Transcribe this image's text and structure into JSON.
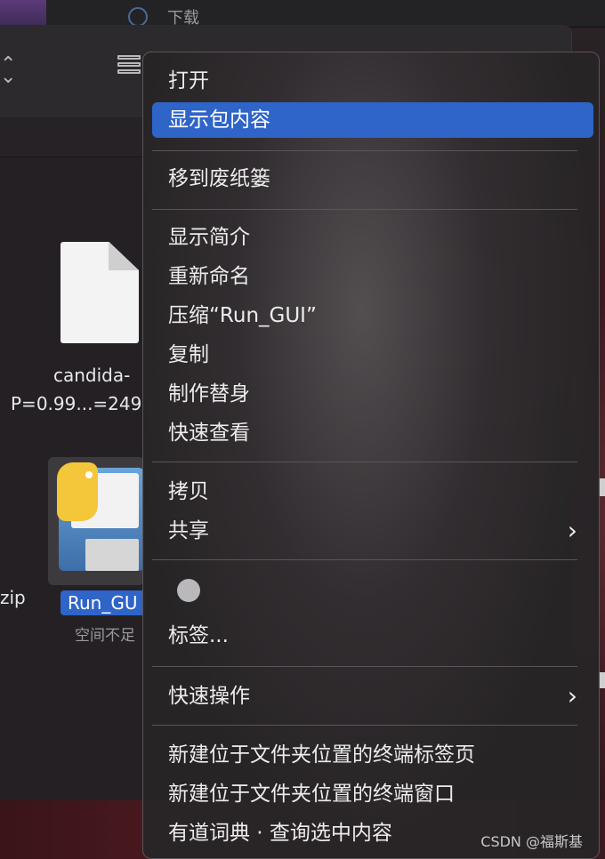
{
  "topbar": {
    "partial_title": "下载"
  },
  "finder": {
    "files": [
      {
        "name_line1": "candida-",
        "name_line2": "P=0.99...=249"
      },
      {
        "name": "Run_GU",
        "subtitle": "空间不足"
      }
    ],
    "zip_suffix": "zip"
  },
  "menu": {
    "open": "打开",
    "show_package": "显示包内容",
    "trash": "移到废纸篓",
    "get_info": "显示简介",
    "rename": "重新命名",
    "compress": "压缩“Run_GUI”",
    "duplicate": "复制",
    "make_alias": "制作替身",
    "quick_look": "快速查看",
    "copy": "拷贝",
    "share": "共享",
    "tags": "标签...",
    "quick_actions": "快速操作",
    "new_terminal_tab": "新建位于文件夹位置的终端标签页",
    "new_terminal_window": "新建位于文件夹位置的终端窗口",
    "youdao": "有道词典 · 查询选中内容"
  },
  "watermark": "CSDN @福斯基",
  "icons": {
    "submenu": "chevron-right-icon",
    "tag": "gray-tag-icon"
  }
}
